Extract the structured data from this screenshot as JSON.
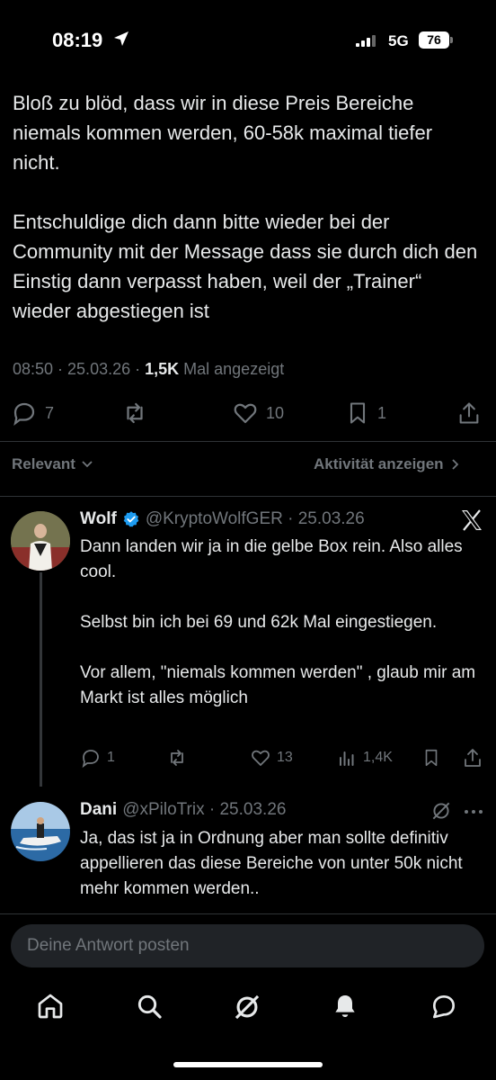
{
  "status_bar": {
    "time": "08:19",
    "network": "5G",
    "battery": "76"
  },
  "post": {
    "text": "Bloß zu blöd, dass wir in diese Preis Bereiche niemals kommen werden, 60-58k maximal tiefer nicht.\n\nEntschuldige dich dann bitte wieder bei der Community mit der Message dass sie durch dich den Einstig dann verpasst haben, weil der „Trainer“ wieder abgestiegen ist",
    "timestamp": "08:50 · 25.03.26 · ",
    "views": "1,5K",
    "views_label": " Mal angezeigt",
    "replies": "7",
    "likes": "10",
    "bookmarks": "1"
  },
  "sort": {
    "left_label": "Relevant",
    "right_label": "Aktivität anzeigen"
  },
  "replies": [
    {
      "name": "Wolf",
      "handle": "@KryptoWolfGER · 25.03.26",
      "text": "Dann landen wir ja in die gelbe Box rein. Also alles cool.\n\nSelbst bin ich bei 69 und 62k Mal eingestiegen.\n\nVor allem, \"niemals kommen werden\" , glaub mir am Markt ist alles möglich",
      "replies": "1",
      "likes": "13",
      "views": "1,4K",
      "verified": true
    },
    {
      "name": "Dani",
      "handle": "@xPiloTrix · 25.03.26",
      "text": "Ja, das ist ja in Ordnung aber man sollte definitiv appellieren das diese Bereiche von unter 50k nicht mehr kommen werden.."
    }
  ],
  "composer": {
    "placeholder": "Deine Antwort posten"
  },
  "colors": {
    "background": "#000000",
    "text": "#e7e9ea",
    "muted": "#71767b",
    "verified": "#1d9bf0"
  },
  "tabs": [
    "home-icon",
    "search-icon",
    "grok-icon",
    "notifications-icon",
    "messages-icon"
  ]
}
